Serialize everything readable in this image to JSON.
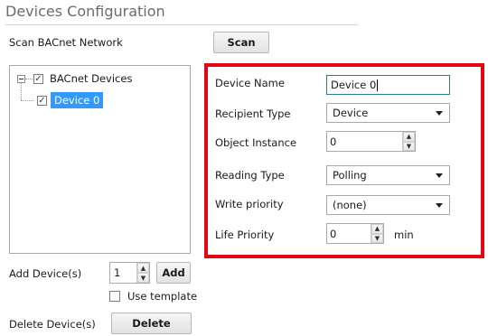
{
  "header": {
    "title": "Devices Configuration"
  },
  "scan": {
    "label": "Scan BACnet Network",
    "button": "Scan"
  },
  "tree": {
    "root_label": "BACnet Devices",
    "child_label": "Device 0"
  },
  "add": {
    "label": "Add Device(s)",
    "value": "1",
    "button": "Add",
    "use_template_label": "Use template"
  },
  "delete": {
    "label": "Delete Device(s)",
    "button": "Delete"
  },
  "form": {
    "device_name_label": "Device Name",
    "device_name_value": "Device 0",
    "recipient_type_label": "Recipient Type",
    "recipient_type_value": "Device",
    "object_instance_label": "Object Instance",
    "object_instance_value": "0",
    "reading_type_label": "Reading Type",
    "reading_type_value": "Polling",
    "write_priority_label": "Write priority",
    "write_priority_value": "(none)",
    "life_priority_label": "Life Priority",
    "life_priority_value": "0",
    "life_priority_unit": "min"
  },
  "colors": {
    "highlight_border": "#e30613",
    "selection": "#3399ff",
    "focus_border": "#2a7f8f"
  }
}
